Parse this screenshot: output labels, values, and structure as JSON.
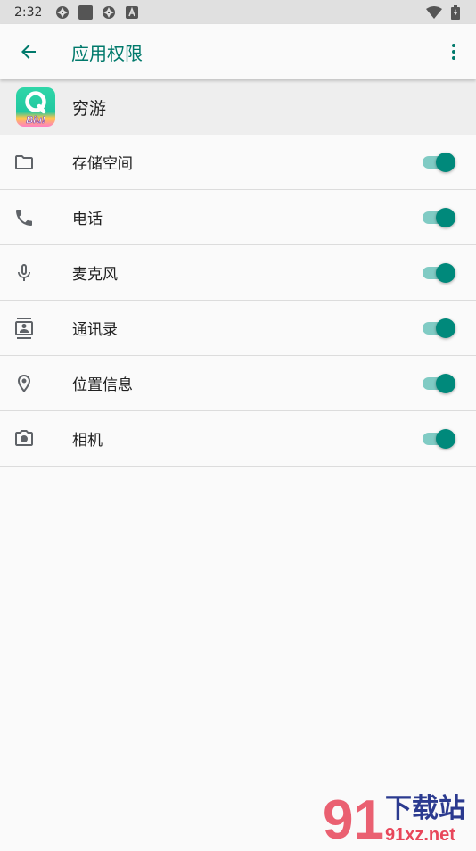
{
  "status_bar": {
    "time": "2:32"
  },
  "toolbar": {
    "title": "应用权限",
    "back_icon": "arrow-back-icon",
    "more_icon": "more-vert-icon"
  },
  "app": {
    "name": "穷游",
    "icon_text": "Biu!"
  },
  "colors": {
    "accent": "#00796b",
    "toggle_thumb": "#00897b",
    "toggle_track": "#80cbc4"
  },
  "permissions": [
    {
      "label": "存储空间",
      "icon": "folder-icon",
      "enabled": true
    },
    {
      "label": "电话",
      "icon": "phone-icon",
      "enabled": true
    },
    {
      "label": "麦克风",
      "icon": "microphone-icon",
      "enabled": true
    },
    {
      "label": "通讯录",
      "icon": "contacts-icon",
      "enabled": true
    },
    {
      "label": "位置信息",
      "icon": "location-icon",
      "enabled": true
    },
    {
      "label": "相机",
      "icon": "camera-icon",
      "enabled": true
    }
  ],
  "watermark": {
    "text": "下载站",
    "url_text": "91xz.net"
  }
}
